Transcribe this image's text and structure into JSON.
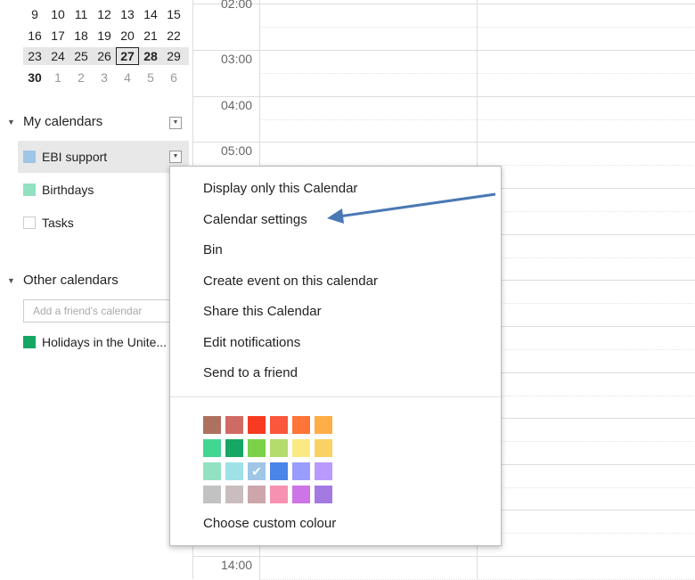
{
  "mini_calendar": {
    "rows": [
      [
        {
          "d": "9"
        },
        {
          "d": "10"
        },
        {
          "d": "11"
        },
        {
          "d": "12"
        },
        {
          "d": "13"
        },
        {
          "d": "14"
        },
        {
          "d": "15"
        }
      ],
      [
        {
          "d": "16"
        },
        {
          "d": "17"
        },
        {
          "d": "18"
        },
        {
          "d": "19"
        },
        {
          "d": "20"
        },
        {
          "d": "21"
        },
        {
          "d": "22"
        }
      ],
      [
        {
          "d": "23"
        },
        {
          "d": "24"
        },
        {
          "d": "25"
        },
        {
          "d": "26"
        },
        {
          "d": "27",
          "today": true
        },
        {
          "d": "28",
          "bold": true
        },
        {
          "d": "29"
        }
      ],
      [
        {
          "d": "30",
          "bold": true
        },
        {
          "d": "1",
          "other": true
        },
        {
          "d": "2",
          "other": true
        },
        {
          "d": "3",
          "other": true
        },
        {
          "d": "4",
          "other": true
        },
        {
          "d": "5",
          "other": true
        },
        {
          "d": "6",
          "other": true
        }
      ]
    ]
  },
  "my_calendars": {
    "heading": "My calendars",
    "items": [
      {
        "label": "EBI support",
        "color": "#9fc6e7"
      },
      {
        "label": "Birthdays",
        "color": "#92e1c0"
      },
      {
        "label": "Tasks",
        "color": "#ffffff"
      }
    ]
  },
  "other_calendars": {
    "heading": "Other calendars",
    "placeholder": "Add a friend's calendar",
    "items": [
      {
        "label": "Holidays in the Unite...",
        "color": "#16a765"
      }
    ]
  },
  "time_labels": [
    "02:00",
    "03:00",
    "04:00",
    "05:00",
    "14:00"
  ],
  "context_menu": {
    "items": [
      "Display only this Calendar",
      "Calendar settings",
      "Bin",
      "Create event on this calendar",
      "Share this Calendar",
      "Edit notifications",
      "Send to a friend"
    ],
    "colors": [
      [
        "#ac725e",
        "#d06b64",
        "#f83a22",
        "#fa573c",
        "#ff7537",
        "#ffad46"
      ],
      [
        "#42d692",
        "#16a765",
        "#7bd148",
        "#b3dc6c",
        "#fbe983",
        "#fad165"
      ],
      [
        "#92e1c0",
        "#9fe1e7",
        "#9fc6e7",
        "#4986e7",
        "#9a9cff",
        "#b99aff"
      ],
      [
        "#c2c2c2",
        "#cabdbf",
        "#cca6ac",
        "#f691b2",
        "#cd74e6",
        "#a47ae2"
      ]
    ],
    "selected_color": "#9fc6e7",
    "custom_label": "Choose custom colour"
  },
  "annotation_color": "#4a78b5"
}
